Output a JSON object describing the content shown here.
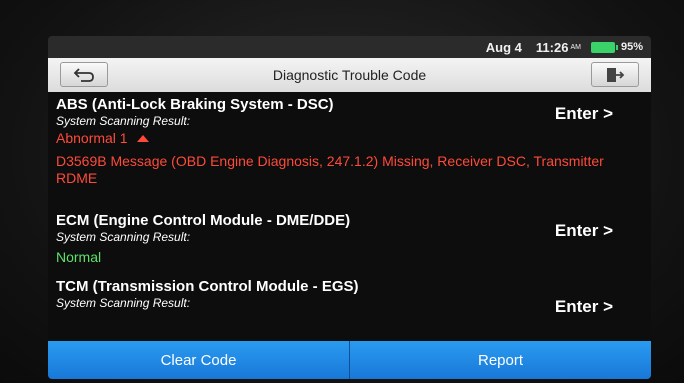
{
  "status_bar": {
    "date": "Aug 4",
    "time": "11:26",
    "ampm": "AM",
    "battery": "95%"
  },
  "header": {
    "title": "Diagnostic Trouble Code",
    "back_icon": "back-arrow-icon",
    "exit_icon": "exit-icon"
  },
  "systems": [
    {
      "title": "ABS (Anti-Lock Braking System - DSC)",
      "subtitle": "System Scanning Result:",
      "enter_label": "Enter >",
      "status": "Abnormal 1",
      "status_color": "#ff4a3a",
      "detail": "D3569B Message (OBD Engine Diagnosis, 247.1.2) Missing, Receiver DSC, Transmitter RDME"
    },
    {
      "title": "ECM (Engine Control Module - DME/DDE)",
      "subtitle": "System Scanning Result:",
      "enter_label": "Enter >",
      "status": "Normal",
      "status_color": "#5ee06a"
    },
    {
      "title": "TCM (Transmission Control Module - EGS)",
      "subtitle": "System Scanning Result:",
      "enter_label": "Enter >"
    }
  ],
  "footer": {
    "clear_code": "Clear Code",
    "report": "Report"
  },
  "colors": {
    "accent": "#1e88e5",
    "error": "#ff4a3a",
    "ok": "#5ee06a"
  }
}
